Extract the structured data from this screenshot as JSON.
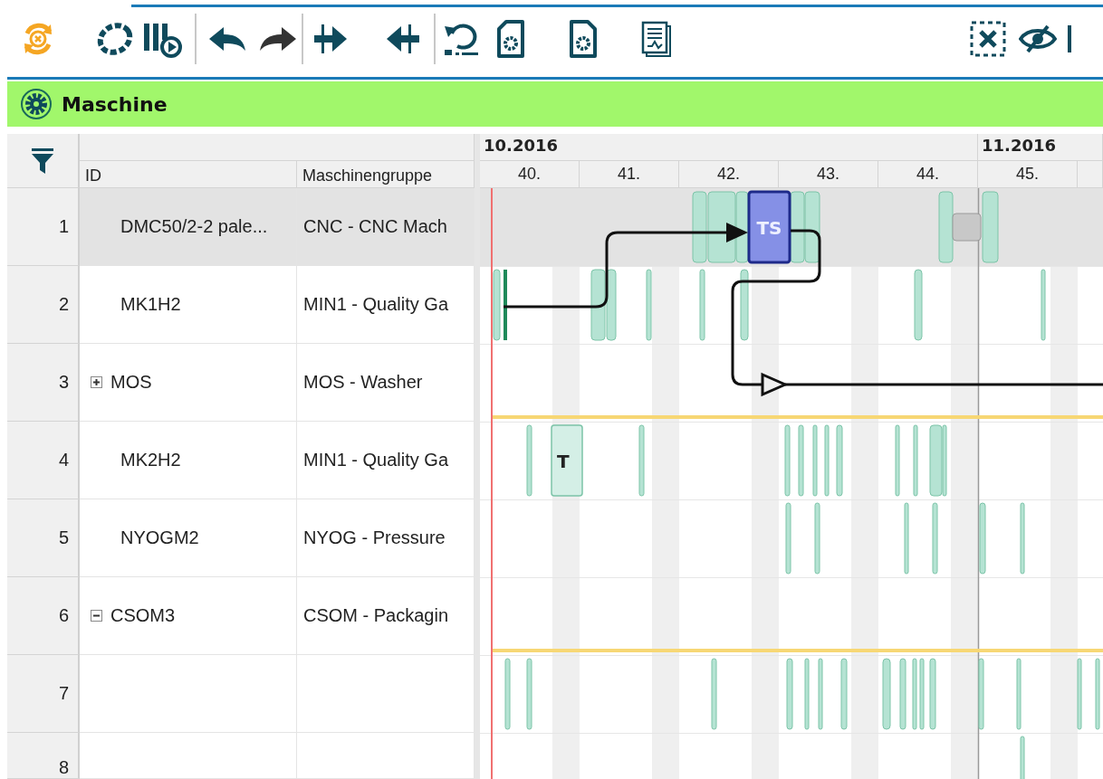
{
  "panel": {
    "title": "Maschine"
  },
  "table": {
    "columns": [
      "ID",
      "Maschinengruppe"
    ],
    "rows": [
      {
        "number": "1",
        "id": "DMC50/2-2 pale...",
        "group": "CNC - CNC Mach",
        "kind": "leaf",
        "selected": true
      },
      {
        "number": "2",
        "id": "MK1H2",
        "group": "MIN1 - Quality Ga",
        "kind": "leaf",
        "selected": false
      },
      {
        "number": "3",
        "id": "MOS",
        "group": "MOS - Washer",
        "kind": "group",
        "expanded": false,
        "selected": false
      },
      {
        "number": "4",
        "id": "MK2H2",
        "group": "MIN1 - Quality Ga",
        "kind": "leaf",
        "selected": false
      },
      {
        "number": "5",
        "id": "NYOGM2",
        "group": "NYOG - Pressure",
        "kind": "leaf",
        "selected": false
      },
      {
        "number": "6",
        "id": "CSOM3",
        "group": "CSOM - Packagin",
        "kind": "group",
        "expanded": true,
        "selected": false
      },
      {
        "number": "7",
        "kind": "leaf",
        "selected": false
      },
      {
        "number": "8",
        "kind": "leaf",
        "selected": false
      }
    ]
  },
  "timeline": {
    "months": [
      "10.2016",
      "11.2016"
    ],
    "weeks": [
      "40.",
      "41.",
      "42.",
      "43.",
      "44.",
      "45."
    ]
  },
  "tasks": [
    {
      "label": "TS",
      "selected": true
    },
    {
      "label": "T",
      "selected": false
    }
  ]
}
